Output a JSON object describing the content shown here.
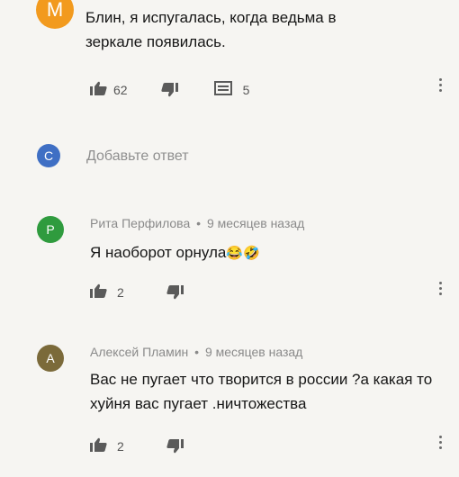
{
  "comment1": {
    "avatar_letter": "M",
    "avatar_color": "#f29a1e",
    "text": "Блин, я испугалась, когда ведьма в зеркале появилась.",
    "likes": "62",
    "replies": "5"
  },
  "reply_box": {
    "avatar_letter": "C",
    "avatar_color": "#3f6fc4",
    "placeholder": "Добавьте ответ"
  },
  "reply1": {
    "avatar_letter": "P",
    "avatar_color": "#2f9b3e",
    "author": "Рита Перфилова",
    "separator": "•",
    "time": "9 месяцев назад",
    "text": "Я наоборот орнула",
    "emoji": "😂🤣",
    "likes": "2"
  },
  "reply2": {
    "avatar_letter": "A",
    "avatar_color": "#7b6a3a",
    "author": "Алексей Пламин",
    "separator": "•",
    "time": "9 месяцев назад",
    "text": "Вас не пугает что творится в россии ?а какая то хуйня вас пугает .ничтожества",
    "likes": "2"
  }
}
